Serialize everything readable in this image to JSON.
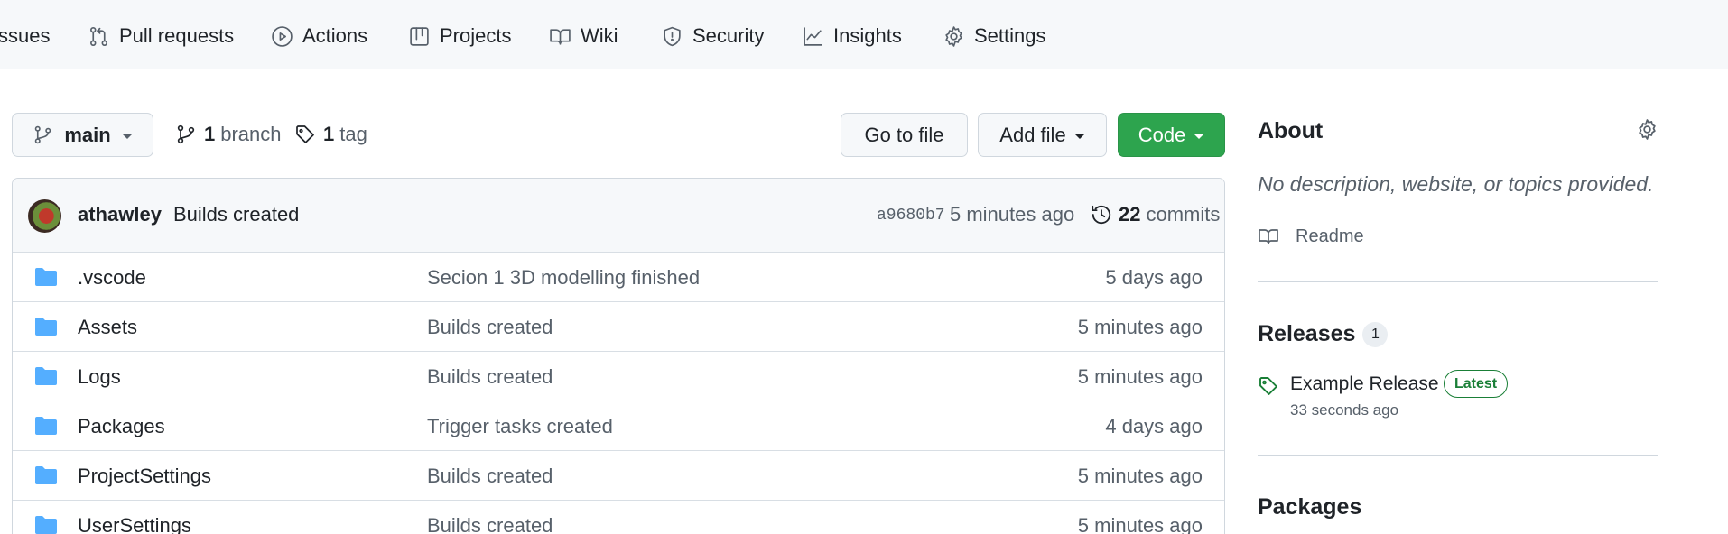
{
  "nav": {
    "items": [
      {
        "label": "ssues",
        "icon": "issue-icon"
      },
      {
        "label": "Pull requests",
        "icon": "pull-request-icon"
      },
      {
        "label": "Actions",
        "icon": "play-icon"
      },
      {
        "label": "Projects",
        "icon": "table-icon"
      },
      {
        "label": "Wiki",
        "icon": "book-icon"
      },
      {
        "label": "Security",
        "icon": "shield-icon"
      },
      {
        "label": "Insights",
        "icon": "graph-icon"
      },
      {
        "label": "Settings",
        "icon": "gear-icon"
      }
    ]
  },
  "repo": {
    "branch_button": "main",
    "branch_count": "1",
    "branch_label": "branch",
    "tag_count": "1",
    "tag_label": "tag",
    "go_to_file": "Go to file",
    "add_file": "Add file",
    "code": "Code"
  },
  "commit": {
    "author": "athawley",
    "message": "Builds created",
    "sha": "a9680b7",
    "time": "5 minutes ago",
    "count": "22",
    "count_label": "commits"
  },
  "files": [
    {
      "name": ".vscode",
      "message": "Secion 1 3D modelling finished",
      "age": "5 days ago"
    },
    {
      "name": "Assets",
      "message": "Builds created",
      "age": "5 minutes ago"
    },
    {
      "name": "Logs",
      "message": "Builds created",
      "age": "5 minutes ago"
    },
    {
      "name": "Packages",
      "message": "Trigger tasks created",
      "age": "4 days ago"
    },
    {
      "name": "ProjectSettings",
      "message": "Builds created",
      "age": "5 minutes ago"
    },
    {
      "name": "UserSettings",
      "message": "Builds created",
      "age": "5 minutes ago"
    }
  ],
  "about": {
    "heading": "About",
    "description": "No description, website, or topics provided.",
    "readme": "Readme"
  },
  "releases": {
    "heading": "Releases",
    "count": "1",
    "name": "Example Release",
    "badge": "Latest",
    "time": "33 seconds ago"
  },
  "packages": {
    "heading": "Packages"
  },
  "colors": {
    "accent_green": "#2da44e",
    "folder_blue": "#54aeff",
    "latest_green": "#1a7f37"
  }
}
